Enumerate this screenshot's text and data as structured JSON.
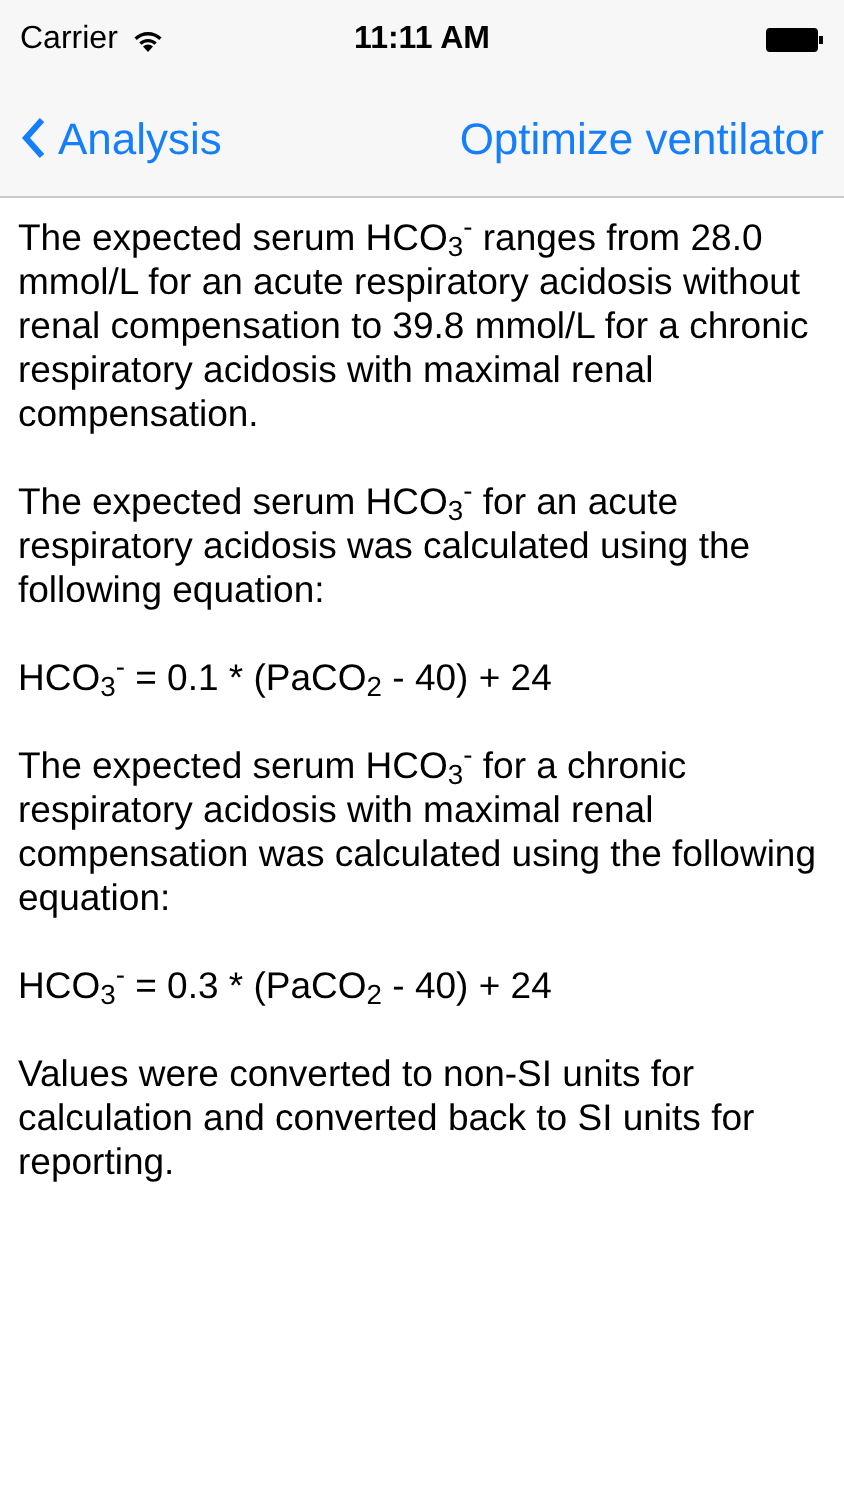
{
  "status_bar": {
    "carrier": "Carrier",
    "time": "11:11 AM"
  },
  "nav_bar": {
    "back": "Analysis",
    "action": "Optimize ventilator"
  },
  "paragraphs": [
    "The expected serum HCO$_{3}$$^{-}$ ranges from 28.0 mmol/L for an acute respiratory acidosis without renal compensation to 39.8 mmol/L for a chronic respiratory acidosis with maximal renal compensation.",
    "The expected serum HCO$_{3}$$^{-}$ for an acute respiratory acidosis was calculated using the following equation:",
    "HCO$_{3}$$^{-}$ = 0.1 * (PaCO$_{2}$ - 40) + 24",
    "The expected serum HCO$_{3}$$^{-}$ for a chronic respiratory acidosis with maximal renal compensation was calculated using the following equation:",
    "HCO$_{3}$$^{-}$ = 0.3 * (PaCO$_{2}$ - 40) + 24",
    "Values were converted to non-SI units for calculation and converted back to SI units for reporting."
  ]
}
